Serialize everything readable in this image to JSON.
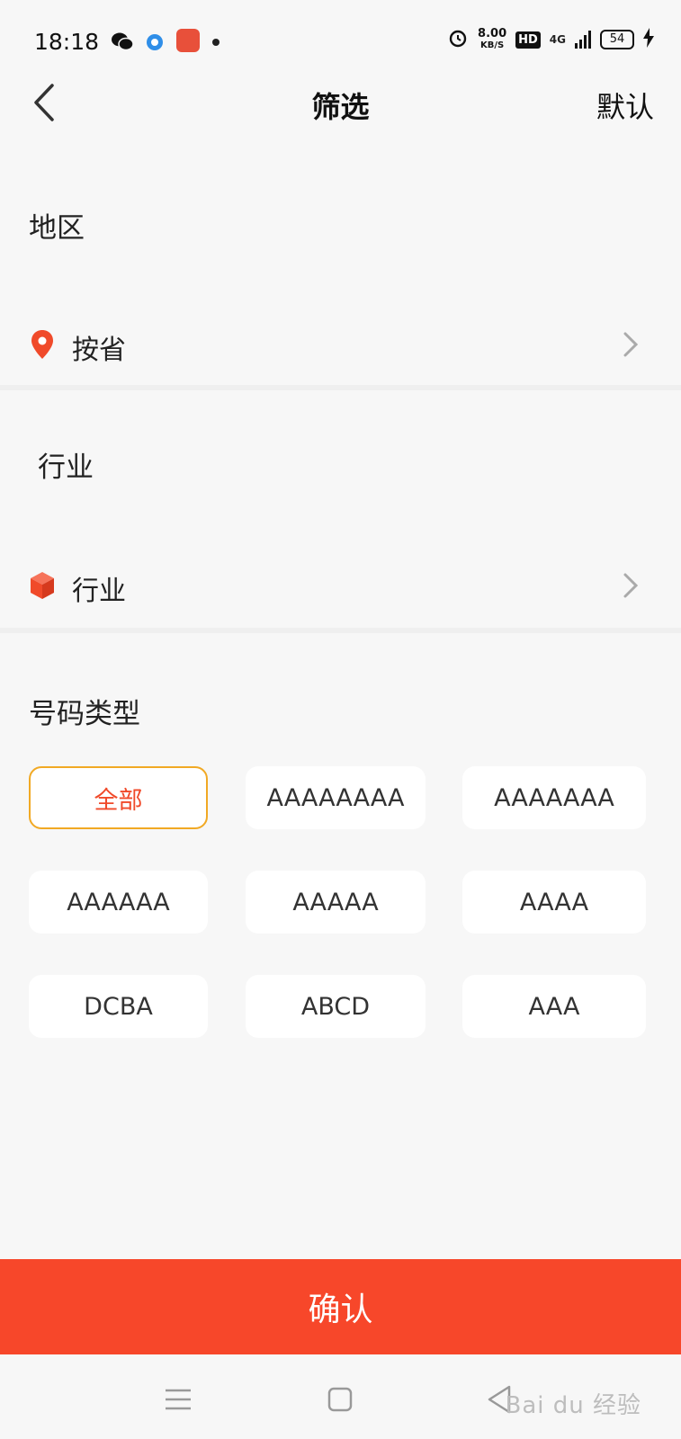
{
  "status_bar": {
    "time": "18:18",
    "speed_value": "8.00",
    "speed_unit": "KB/S",
    "hd": "HD",
    "network": "4G",
    "battery": "54"
  },
  "header": {
    "title": "筛选",
    "default_label": "默认"
  },
  "region": {
    "title": "地区",
    "row_label": "按省"
  },
  "industry": {
    "title": "行业",
    "row_label": "行业"
  },
  "number_type": {
    "title": "号码类型",
    "options": [
      "全部",
      "AAAAAAAA",
      "AAAAAAA",
      "AAAAAA",
      "AAAAA",
      "AAAA",
      "DCBA",
      "ABCD",
      "AAA"
    ],
    "selected": "全部"
  },
  "footer": {
    "confirm_label": "确认"
  },
  "watermark": "Bai du 经验",
  "colors": {
    "accent": "#f7472a",
    "selected_border": "#f1a924",
    "selected_text": "#f04a2a"
  }
}
